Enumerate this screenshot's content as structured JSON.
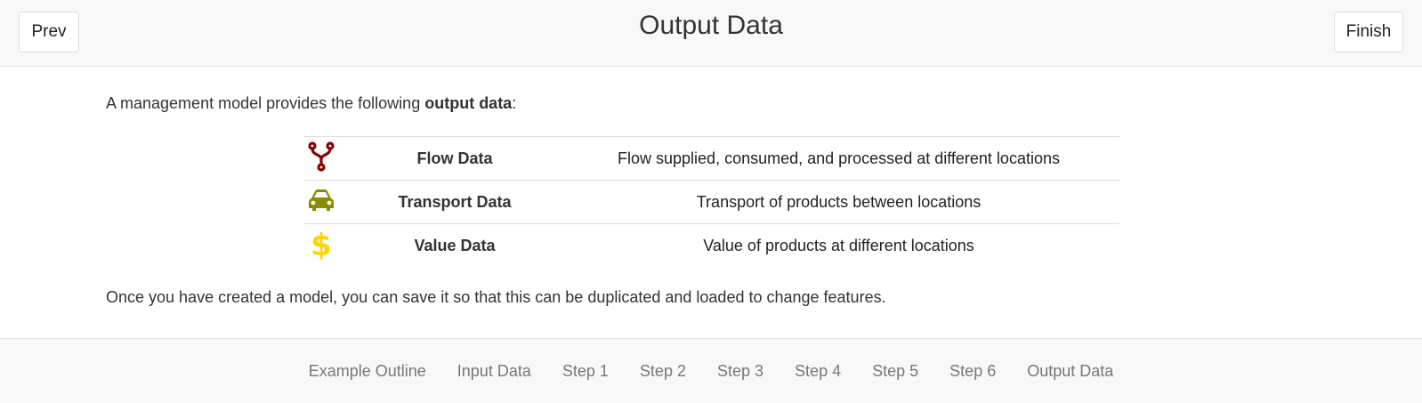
{
  "header": {
    "title": "Output Data",
    "prev_label": "Prev",
    "finish_label": "Finish"
  },
  "content": {
    "intro_text": "A management model provides the following ",
    "intro_bold": "output data",
    "intro_end": ":",
    "rows": [
      {
        "icon": "fork-icon",
        "icon_color": "#8b0000",
        "name": "Flow Data",
        "description": "Flow supplied, consumed, and processed at different locations"
      },
      {
        "icon": "car-icon",
        "icon_color": "#8b8b00",
        "name": "Transport Data",
        "description": "Transport of products between locations"
      },
      {
        "icon": "dollar-icon",
        "icon_color": "#ffd700",
        "name": "Value Data",
        "description": "Value of products at different locations"
      }
    ],
    "outro_text": "Once you have created a model, you can save it so that this can be duplicated and loaded to change features."
  },
  "footer": {
    "links": [
      "Example Outline",
      "Input Data",
      "Step 1",
      "Step 2",
      "Step 3",
      "Step 4",
      "Step 5",
      "Step 6",
      "Output Data"
    ]
  }
}
